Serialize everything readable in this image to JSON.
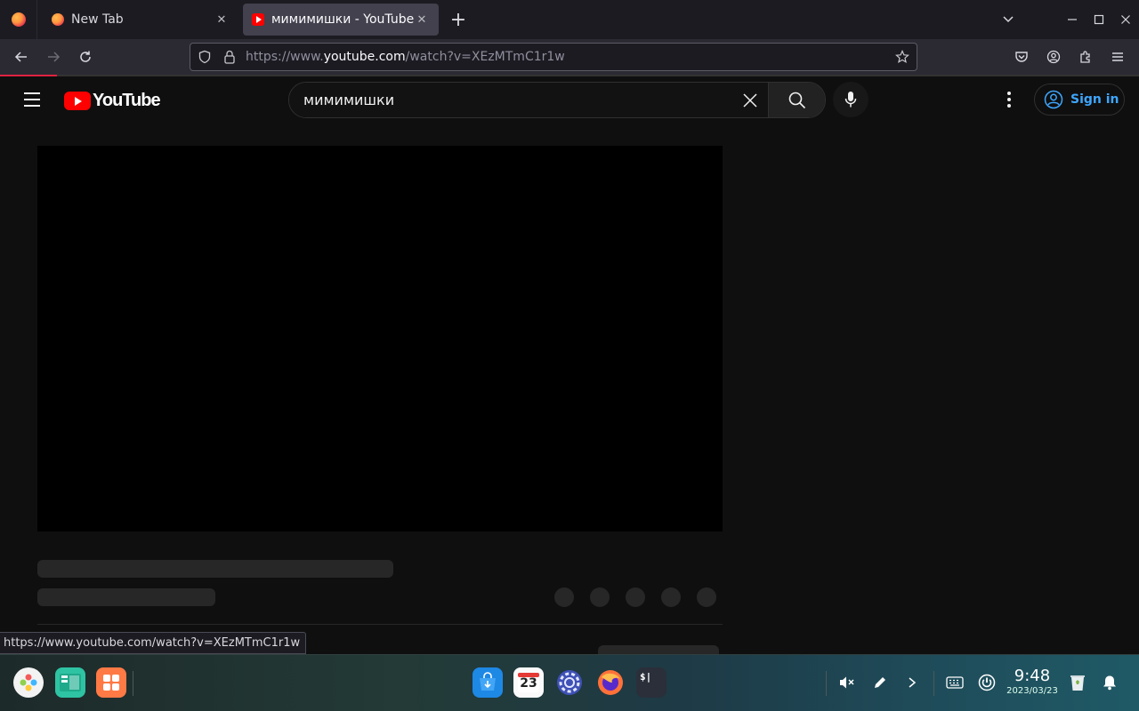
{
  "browser": {
    "tabs": [
      {
        "title": "New Tab",
        "favicon": "firefox-icon",
        "active": false
      },
      {
        "title": "мимимишки - YouTube",
        "favicon": "youtube-icon",
        "active": true
      }
    ],
    "url_prefix": "https://www.",
    "url_host": "youtube.com",
    "url_path": "/watch?v=XEzMTmC1r1w",
    "status_url": "https://www.youtube.com/watch?v=XEzMTmC1r1w",
    "load_progress": 0.05,
    "accent": "#e0223f"
  },
  "youtube": {
    "logo_text": "YouTube",
    "search_query": "мимимишки",
    "signin_label": "Sign in",
    "brand_color": "#ff0000",
    "link_color": "#3ea6ff"
  },
  "taskbar": {
    "time": "9:48",
    "date": "2023/03/23",
    "calendar_day": "23",
    "terminal_label": "$|"
  }
}
